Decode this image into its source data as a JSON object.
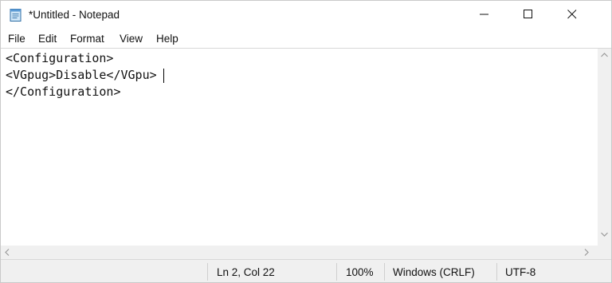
{
  "window": {
    "title": "*Untitled - Notepad",
    "icon": "notepad-icon"
  },
  "menu": {
    "items": [
      "File",
      "Edit",
      "Format",
      "View",
      "Help"
    ]
  },
  "editor": {
    "lines": [
      "<Configuration>",
      "<VGpug>Disable</VGpu>",
      "</Configuration>"
    ]
  },
  "status": {
    "position": "Ln 2, Col 22",
    "zoom": "100%",
    "line_ending": "Windows (CRLF)",
    "encoding": "UTF-8"
  }
}
